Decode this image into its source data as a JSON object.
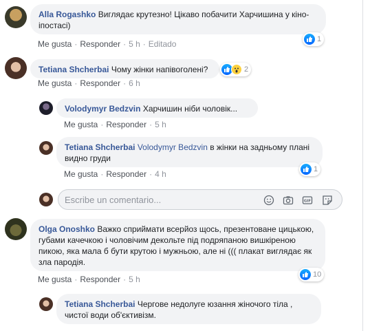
{
  "comments": [
    {
      "author": "Alla Rogashko",
      "text": "Виглядає крутезно! Цікаво побачити Харчишина у кіно-іпостасі)",
      "like": "Me gusta",
      "reply": "Responder",
      "time": "5 h",
      "edited": "Editado",
      "reaction_count": "1"
    },
    {
      "author": "Tetiana Shcherbai",
      "text": "Чому жінки напівоголені?",
      "like": "Me gusta",
      "reply": "Responder",
      "time": "6 h",
      "reaction_count": "2"
    },
    {
      "author": "Volodymyr Bedzvin",
      "text": "Харчишин ніби чоловік...",
      "like": "Me gusta",
      "reply": "Responder",
      "time": "5 h"
    },
    {
      "author": "Tetiana Shcherbai",
      "mention": "Volodymyr Bedzvin",
      "text": " в жінки на задньому плані видно груди",
      "like": "Me gusta",
      "reply": "Responder",
      "time": "4 h",
      "reaction_count": "1"
    },
    {
      "author": "Olga Onoshko",
      "text": "Важко сприймати всерйоз щось, презентоване цицькою, губами качечкою і чоловічим декольте під подряпаною вишкіреною пикою, яка мала б бути крутою і мужньою, але ні ((( плакат виглядає як зла пародія.",
      "like": "Me gusta",
      "reply": "Responder",
      "time": "5 h",
      "reaction_count": "10"
    },
    {
      "author": "Tetiana Shcherbai",
      "text": "Чергове недолуге юзання жіночого тіла , чистої води об'єктивізм."
    }
  ],
  "composer": {
    "placeholder": "Escribe un comentario...",
    "icons": [
      "emoji-icon",
      "camera-icon",
      "gif-icon",
      "sticker-icon"
    ]
  },
  "colors": {
    "author": "#385898",
    "bubble": "#f2f3f5",
    "like": "#0866ff"
  }
}
